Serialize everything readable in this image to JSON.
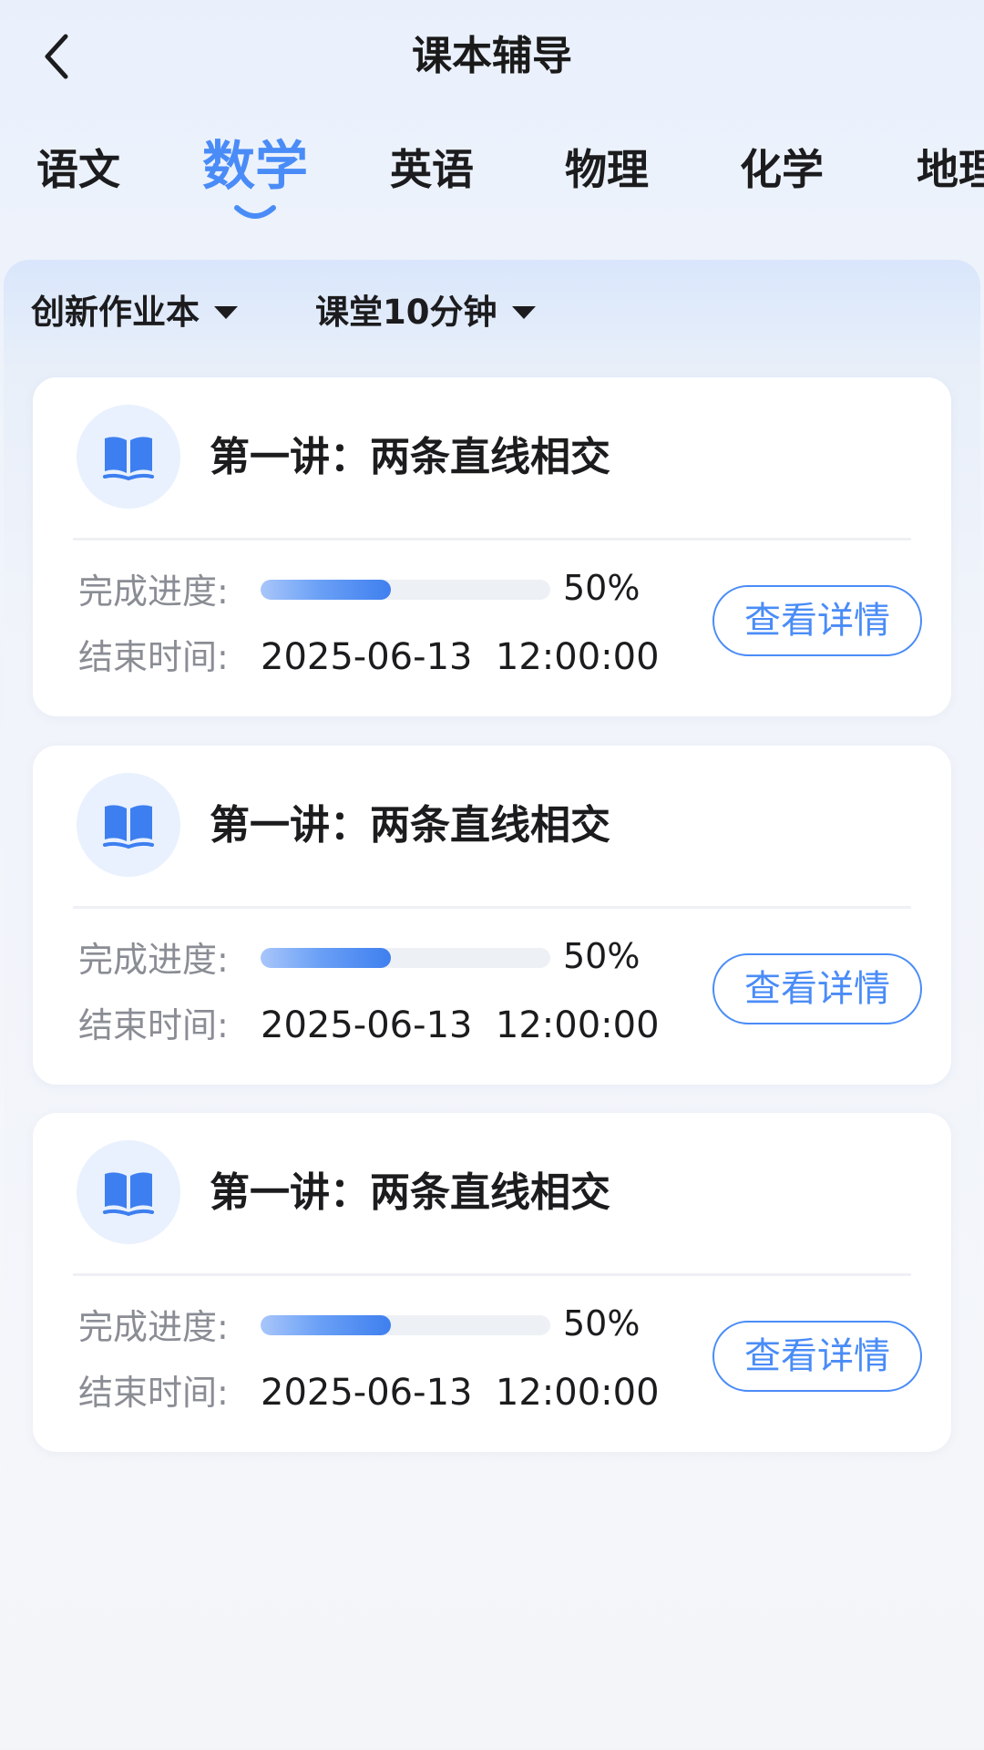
{
  "header": {
    "title": "课本辅导",
    "back_icon": "chevron-left-icon"
  },
  "tabs": [
    {
      "label": "语文",
      "active": false
    },
    {
      "label": "数学",
      "active": true
    },
    {
      "label": "英语",
      "active": false
    },
    {
      "label": "物理",
      "active": false
    },
    {
      "label": "化学",
      "active": false
    },
    {
      "label": "地理",
      "active": false
    }
  ],
  "filters": [
    {
      "label": "创新作业本",
      "icon": "caret-down-icon"
    },
    {
      "label": "课堂10分钟",
      "icon": "caret-down-icon"
    }
  ],
  "cards": [
    {
      "icon": "open-book-icon",
      "title": "第一讲：两条直线相交",
      "progress_label": "完成进度:",
      "progress_value": 0.45,
      "progress_text": "50%",
      "end_label": "结束时间:",
      "end_time": "2025-06-13  12:00:00",
      "button_label": "查看详情"
    },
    {
      "icon": "open-book-icon",
      "title": "第一讲：两条直线相交",
      "progress_label": "完成进度:",
      "progress_value": 0.45,
      "progress_text": "50%",
      "end_label": "结束时间:",
      "end_time": "2025-06-13  12:00:00",
      "button_label": "查看详情"
    },
    {
      "icon": "open-book-icon",
      "title": "第一讲：两条直线相交",
      "progress_label": "完成进度:",
      "progress_value": 0.45,
      "progress_text": "50%",
      "end_label": "结束时间:",
      "end_time": "2025-06-13  12:00:00",
      "button_label": "查看详情"
    }
  ],
  "colors": {
    "accent": "#4a8cf7",
    "icon_bg": "#e9f1fe",
    "muted_text": "#8a8d94"
  }
}
